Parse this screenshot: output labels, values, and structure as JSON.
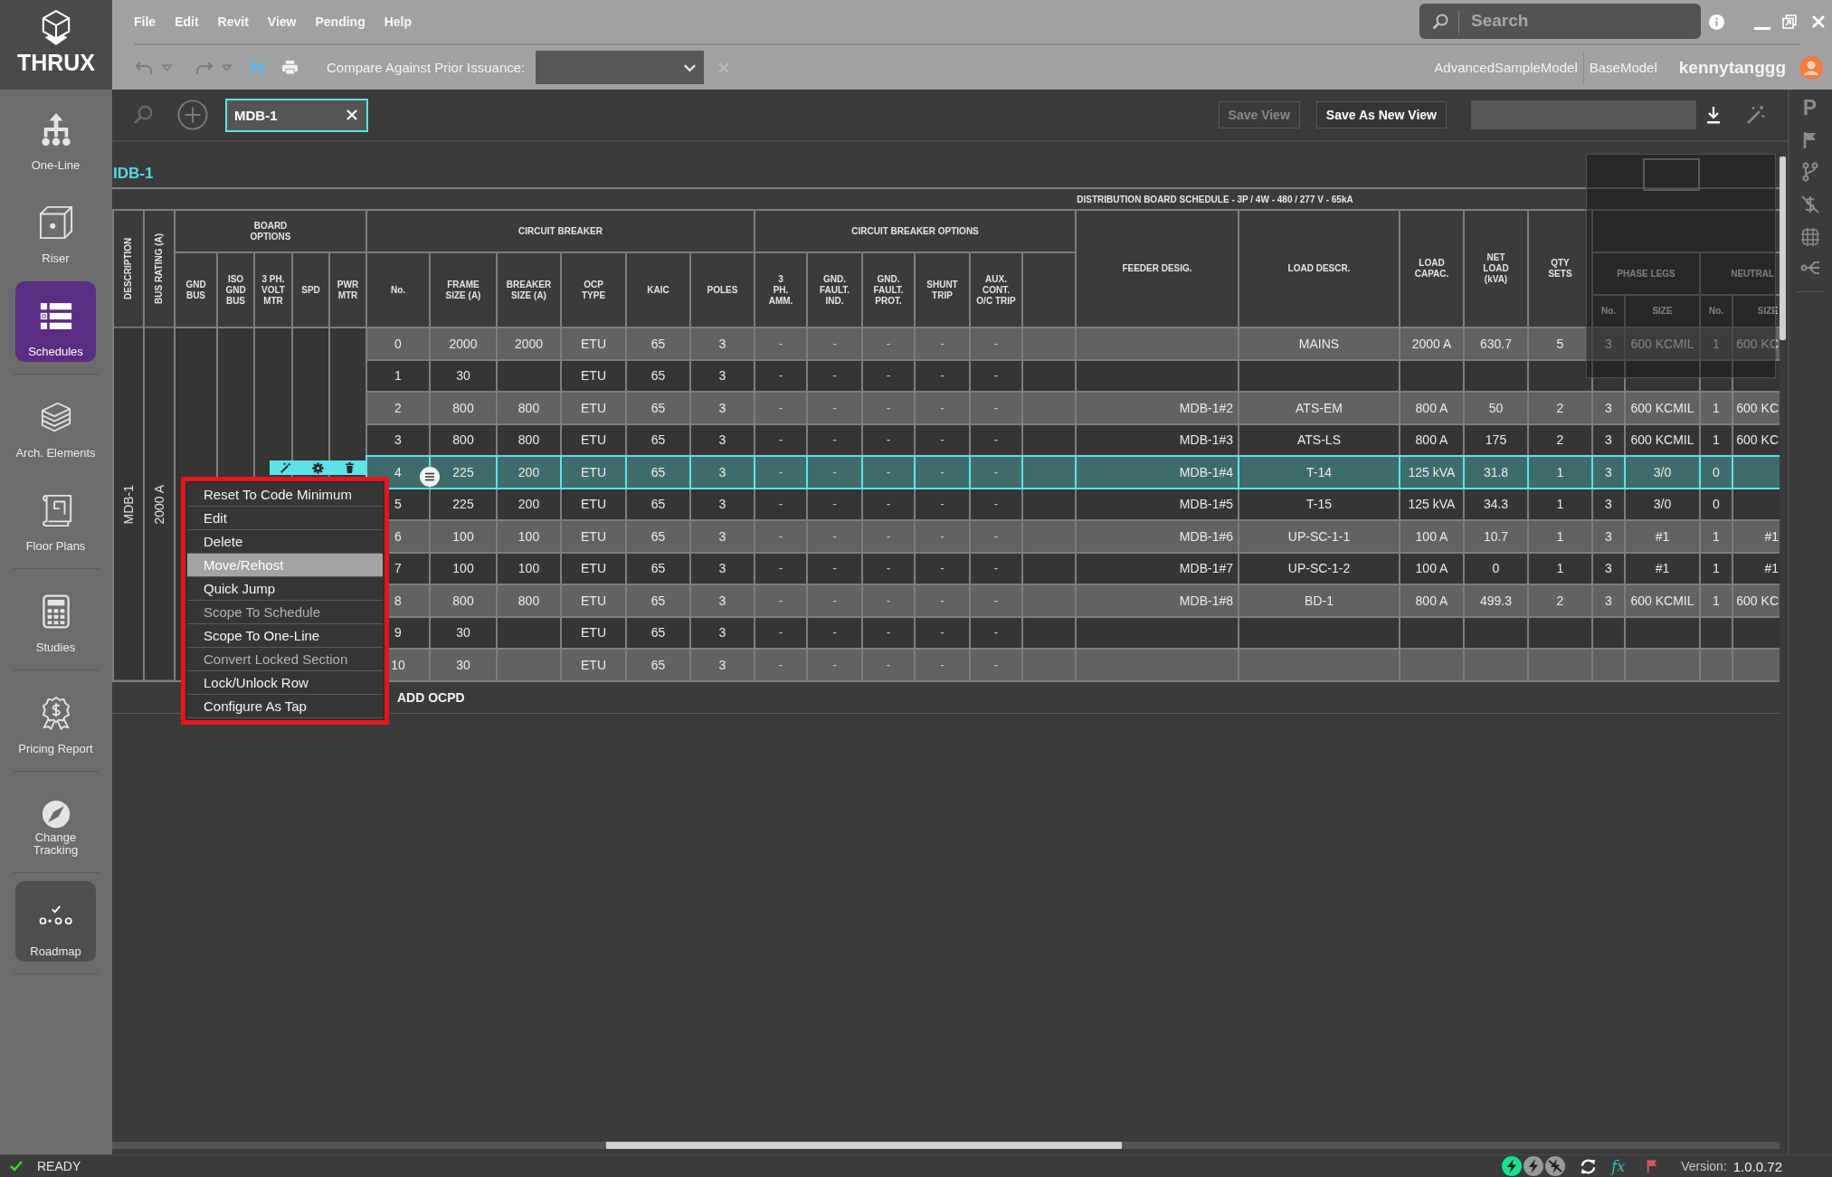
{
  "app": {
    "logo": "THRUX"
  },
  "menu_bar": [
    "File",
    "Edit",
    "Revit",
    "View",
    "Pending",
    "Help"
  ],
  "search": {
    "placeholder": "Search"
  },
  "toolbar": {
    "compare_label": "Compare Against Prior Issuance:",
    "clear_disabled": true
  },
  "models": [
    "AdvancedSampleModel",
    "BaseModel"
  ],
  "user": {
    "name": "kennytanggg"
  },
  "sidebar": {
    "groups": [
      {
        "items": [
          {
            "label": "One-Line",
            "kind": "nav",
            "selected": false
          },
          {
            "label": "Riser",
            "kind": "nav",
            "selected": false
          },
          {
            "label": "Schedules",
            "kind": "nav",
            "selected": true
          }
        ]
      },
      {
        "items": [
          {
            "label": "Arch. Elements",
            "kind": "nav",
            "selected": false
          },
          {
            "label": "Floor Plans",
            "kind": "nav",
            "selected": false
          }
        ]
      },
      {
        "items": [
          {
            "label": "Studies",
            "kind": "nav",
            "selected": false
          }
        ]
      },
      {
        "items": [
          {
            "label": "Pricing Report",
            "kind": "nav",
            "selected": false
          }
        ]
      },
      {
        "items": [
          {
            "label": "Change\nTracking",
            "kind": "nav",
            "selected": false
          }
        ]
      },
      {
        "items": [
          {
            "label": "Roadmap",
            "kind": "tile",
            "selected": false
          }
        ]
      }
    ]
  },
  "view_bar": {
    "tabs": [
      {
        "label": "MDB-1",
        "selected": true
      }
    ],
    "buttons": [
      {
        "label": "Save View",
        "disabled": true
      },
      {
        "label": "Save As New View",
        "disabled": false
      }
    ]
  },
  "schedule": {
    "name": "IDB-1",
    "title": "DISTRIBUTION BOARD SCHEDULE - 3P / 4W - 480 / 277 V - 65kA",
    "fixed_columns": [
      "DESCRIPTION",
      "BUS RATING (A)"
    ],
    "column_groups": [
      {
        "label": "BOARD\nOPTIONS",
        "columns": [
          "GND\nBUS",
          "ISO\nGND\nBUS",
          "3 PH.\nVOLT\nMTR",
          "SPD",
          "PWR\nMTR"
        ]
      },
      {
        "label": "CIRCUIT BREAKER",
        "columns": [
          "No.",
          "FRAME\nSIZE (A)",
          "BREAKER\nSIZE (A)",
          "OCP\nTYPE",
          "KAIC",
          "POLES"
        ]
      },
      {
        "label": "CIRCUIT BREAKER OPTIONS",
        "columns": [
          "3\nPH.\nAMM.",
          "GND.\nFAULT.\nIND.",
          "GND.\nFAULT.\nPROT.",
          "SHUNT\nTRIP",
          "AUX.\nCONT.\nO/C TRIP"
        ]
      }
    ],
    "columns": [
      "FEEDER DESIG.",
      "LOAD DESCR.",
      "LOAD\nCAPAC.",
      "NET\nLOAD\n(kVA)",
      "QTY\nSETS"
    ],
    "conductor_groups": [
      {
        "label": "PHASE LEGS",
        "columns": [
          "No.",
          "SIZE"
        ]
      },
      {
        "label": "NEUTRAL",
        "columns": [
          "No.",
          "SIZE"
        ]
      }
    ],
    "description": "MDB-1",
    "bus_rating": "2000 A",
    "rows": [
      {
        "no": "0",
        "frame": "2000",
        "breaker": "2000",
        "ocp": "ETU",
        "kaic": "65",
        "poles": "3",
        "options": [
          "-",
          "-",
          "-",
          "-",
          "-"
        ],
        "load": "MAINS",
        "capacity": "2000 A",
        "net_load": "630.7",
        "qty": "5",
        "phase_no": "3",
        "phase_size": "600 KCMIL",
        "neutral_no": "1",
        "neutral_size": "600 KC",
        "selected": false
      },
      {
        "no": "1",
        "frame": "30",
        "ocp": "ETU",
        "kaic": "65",
        "poles": "3",
        "options": [
          "-",
          "-",
          "-",
          "-",
          "-"
        ],
        "selected": false
      },
      {
        "no": "2",
        "frame": "800",
        "breaker": "800",
        "ocp": "ETU",
        "kaic": "65",
        "poles": "3",
        "options": [
          "-",
          "-",
          "-",
          "-",
          "-"
        ],
        "feeder": "MDB-1#2",
        "load": "ATS-EM",
        "capacity": "800 A",
        "net_load": "50",
        "qty": "2",
        "phase_no": "3",
        "phase_size": "600 KCMIL",
        "neutral_no": "1",
        "neutral_size": "600 KC",
        "selected": false
      },
      {
        "no": "3",
        "frame": "800",
        "breaker": "800",
        "ocp": "ETU",
        "kaic": "65",
        "poles": "3",
        "options": [
          "-",
          "-",
          "-",
          "-",
          "-"
        ],
        "feeder": "MDB-1#3",
        "load": "ATS-LS",
        "capacity": "800 A",
        "net_load": "175",
        "qty": "2",
        "phase_no": "3",
        "phase_size": "600 KCMIL",
        "neutral_no": "1",
        "neutral_size": "600 KC",
        "selected": false
      },
      {
        "no": "4",
        "frame": "225",
        "breaker": "200",
        "ocp": "ETU",
        "kaic": "65",
        "poles": "3",
        "options": [
          "-",
          "-",
          "-",
          "-",
          "-"
        ],
        "feeder": "MDB-1#4",
        "load": "T-14",
        "capacity": "125 kVA",
        "net_load": "31.8",
        "qty": "1",
        "phase_no": "3",
        "phase_size": "3/0",
        "neutral_no": "0",
        "selected": true
      },
      {
        "no": "5",
        "frame": "225",
        "breaker": "200",
        "ocp": "ETU",
        "kaic": "65",
        "poles": "3",
        "options": [
          "-",
          "-",
          "-",
          "-",
          "-"
        ],
        "feeder": "MDB-1#5",
        "load": "T-15",
        "capacity": "125 kVA",
        "net_load": "34.3",
        "qty": "1",
        "phase_no": "3",
        "phase_size": "3/0",
        "neutral_no": "0",
        "selected": false
      },
      {
        "no": "6",
        "frame": "100",
        "breaker": "100",
        "ocp": "ETU",
        "kaic": "65",
        "poles": "3",
        "options": [
          "-",
          "-",
          "-",
          "-",
          "-"
        ],
        "feeder": "MDB-1#6",
        "load": "UP-SC-1-1",
        "capacity": "100 A",
        "net_load": "10.7",
        "qty": "1",
        "phase_no": "3",
        "phase_size": "#1",
        "neutral_no": "1",
        "neutral_size": "#1",
        "selected": false
      },
      {
        "no": "7",
        "frame": "100",
        "breaker": "100",
        "ocp": "ETU",
        "kaic": "65",
        "poles": "3",
        "options": [
          "-",
          "-",
          "-",
          "-",
          "-"
        ],
        "feeder": "MDB-1#7",
        "load": "UP-SC-1-2",
        "capacity": "100 A",
        "net_load": "0",
        "qty": "1",
        "phase_no": "3",
        "phase_size": "#1",
        "neutral_no": "1",
        "neutral_size": "#1",
        "selected": false
      },
      {
        "no": "8",
        "frame": "800",
        "breaker": "800",
        "ocp": "ETU",
        "kaic": "65",
        "poles": "3",
        "options": [
          "-",
          "-",
          "-",
          "-",
          "-"
        ],
        "feeder": "MDB-1#8",
        "load": "BD-1",
        "capacity": "800 A",
        "net_load": "499.3",
        "qty": "2",
        "phase_no": "3",
        "phase_size": "600 KCMIL",
        "neutral_no": "1",
        "neutral_size": "600 KC",
        "selected": false
      },
      {
        "no": "9",
        "frame": "30",
        "ocp": "ETU",
        "kaic": "65",
        "poles": "3",
        "options": [
          "-",
          "-",
          "-",
          "-",
          "-"
        ],
        "selected": false
      },
      {
        "no": "10",
        "frame": "30",
        "ocp": "ETU",
        "kaic": "65",
        "poles": "3",
        "options": [
          "-",
          "-",
          "-",
          "-",
          "-"
        ],
        "selected": false
      }
    ],
    "add_button": "ADD OCPD"
  },
  "context_menu": {
    "items": [
      {
        "label": "Reset To Code Minimum",
        "selected": false,
        "disabled": false
      },
      {
        "label": "Edit",
        "selected": false,
        "disabled": false
      },
      {
        "label": "Delete",
        "selected": false,
        "disabled": false
      },
      {
        "label": "Move/Rehost",
        "selected": true,
        "disabled": false
      },
      {
        "label": "Quick Jump",
        "selected": false,
        "disabled": false
      },
      {
        "label": "Scope To Schedule",
        "selected": false,
        "disabled": true
      },
      {
        "label": "Scope To One-Line",
        "selected": false,
        "disabled": false
      },
      {
        "label": "Convert Locked Section",
        "selected": false,
        "disabled": true
      },
      {
        "label": "Lock/Unlock Row",
        "selected": false,
        "disabled": false
      },
      {
        "label": "Configure As Tap",
        "selected": false,
        "disabled": false
      }
    ]
  },
  "side_panel": {
    "label": "P"
  },
  "status_bar": {
    "status": "READY",
    "indicators": [
      {
        "kind": "bolt",
        "on": true
      },
      {
        "kind": "bolt",
        "on": false
      },
      {
        "kind": "bolt-off",
        "on": false
      }
    ],
    "formula_label": "fx",
    "version_label": "Version:",
    "version": "1.0.0.72"
  }
}
